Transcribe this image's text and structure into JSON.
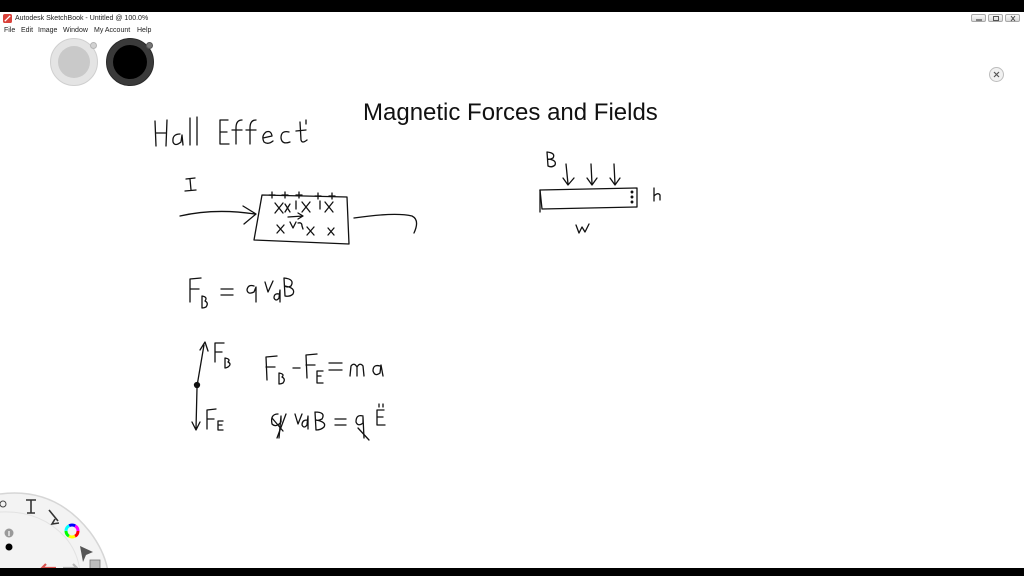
{
  "window": {
    "title": "Autodesk SketchBook - Untitled @ 100.0%"
  },
  "menu": {
    "items": [
      {
        "label": "File"
      },
      {
        "label": "Edit"
      },
      {
        "label": "Image"
      },
      {
        "label": "Window"
      },
      {
        "label": "My Account"
      },
      {
        "label": "Help"
      }
    ]
  },
  "canvas": {
    "title": "Magnetic Forces and Fields",
    "handwriting": {
      "heading": "Hall Effect",
      "current_label": "I",
      "field_label": "B",
      "height_label": "h",
      "width_label": "w",
      "force_equation": "F_B = q v_d B",
      "force_b_label": "F_B",
      "force_e_label": "F_E",
      "net_force_equation": "F_B - F_E = m a",
      "balance_equation": "q v_d B = q E"
    }
  },
  "colors": {
    "ink": "#111111",
    "canvas_background": "#ffffff",
    "color_wheel": [
      "#ff0000",
      "#ffff00",
      "#00ff00",
      "#00ffff",
      "#0000ff",
      "#ff00ff"
    ],
    "undo_arrow": "#d9534f"
  },
  "icons": {
    "brush_puck_light": "brush-puck-icon",
    "brush_puck_dark": "color-puck-icon",
    "close": "close-icon",
    "lagoon": [
      "undo-icon",
      "redo-icon",
      "layers-icon",
      "color-wheel-icon",
      "brush-icon",
      "select-icon",
      "text-icon",
      "ellipse-icon"
    ]
  }
}
